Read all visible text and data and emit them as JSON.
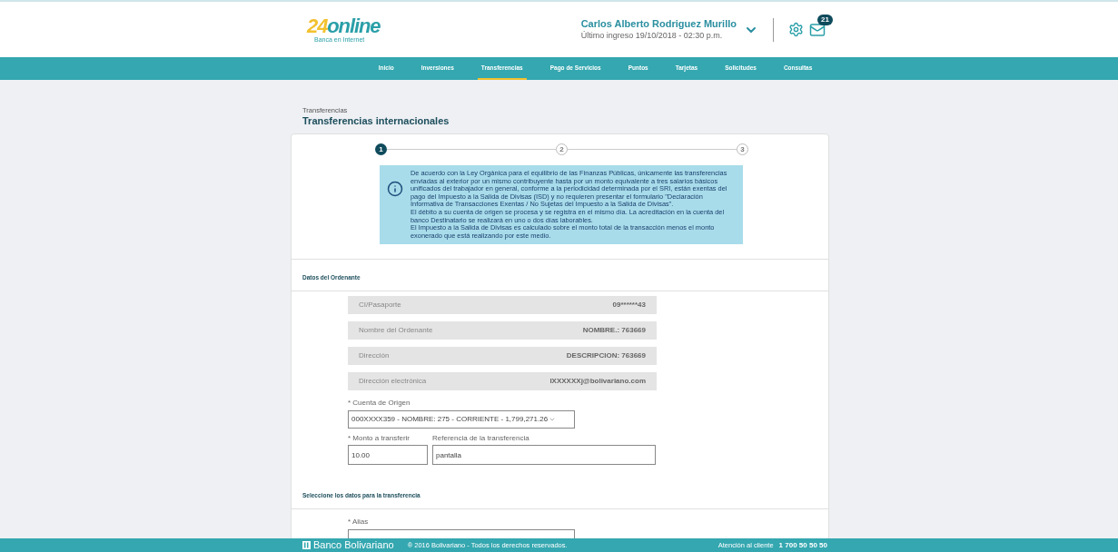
{
  "header": {
    "logo": {
      "digits": "24",
      "word": "online",
      "tagline": "Banca en Internet"
    },
    "user": {
      "name": "Carlos Alberto Rodriguez Murillo",
      "last_login": "Último ingreso 19/10/2018 - 02:30 p.m."
    },
    "messages_badge": "21"
  },
  "nav": [
    {
      "label": "Inicio",
      "selected": false
    },
    {
      "label": "Inversiones",
      "selected": false
    },
    {
      "label": "Transferencias",
      "selected": true
    },
    {
      "label": "Pago de Servicios",
      "selected": false
    },
    {
      "label": "Puntos",
      "selected": false
    },
    {
      "label": "Tarjetas",
      "selected": false
    },
    {
      "label": "Solicitudes",
      "selected": false
    },
    {
      "label": "Consultas",
      "selected": false
    }
  ],
  "breadcrumb": "Transferencias",
  "title": "Transferencias internacionales",
  "steps": [
    {
      "label": "1",
      "selected": true
    },
    {
      "label": "2",
      "selected": false
    },
    {
      "label": "3",
      "selected": false
    }
  ],
  "info": [
    "De acuerdo con la Ley Orgánica para el equilibrio de las Finanzas Públicas, únicamente las transferencias enviadas al exterior por un mismo contribuyente hasta por un monto equivalente a tres salarios básicos unificados del trabajador en general, conforme a la periodicidad determinada por el SRI, están exentas del pago del Impuesto a la Salida de Divisas (ISD) y no requieren presentar el formulario \"Declaración Informativa de Transacciones Exentas / No Sujetas del Impuesto a la Salida de Divisas\".",
    "El débito a su cuenta de origen se procesa y se registra en el mismo día. La acreditación en la cuenta del banco Destinatario se realizará en uno o dos días laborables.",
    "El Impuesto a la Salida de Divisas es calculado sobre el monto total de la transacción menos el monto exonerado que está realizando por este medio."
  ],
  "ordenante": {
    "heading": "Datos del Ordenante",
    "rows": [
      {
        "label": "CI/Pasaporte",
        "value": "09******43"
      },
      {
        "label": "Nombre del Ordenante",
        "value": "NOMBRE.: 763669"
      },
      {
        "label": "Dirección",
        "value": "DESCRIPCION: 763669"
      },
      {
        "label": "Dirección electrónica",
        "value": "IXXXXXXj@bolivariano.com"
      }
    ],
    "cuenta": {
      "label": "* Cuenta de Origen",
      "value": "000XXXX359 - NOMBRE: 275 - CORRIENTE - 1,799,271.26"
    },
    "monto": {
      "label": "* Monto a transferir",
      "value": "10.00"
    },
    "referencia": {
      "label": "Referencia de la transferencia",
      "value": "pantalla"
    }
  },
  "transferencia": {
    "heading": "Seleccione los datos para la transferencia",
    "alias": {
      "label": "* Alias"
    }
  },
  "footer": {
    "brand": "Banco Bolivariano",
    "copyright": "® 2016 Bolivariano - Todos los derechos reservados.",
    "contact_label": "Atención al cliente",
    "phone": "1 700 50 50 50"
  }
}
